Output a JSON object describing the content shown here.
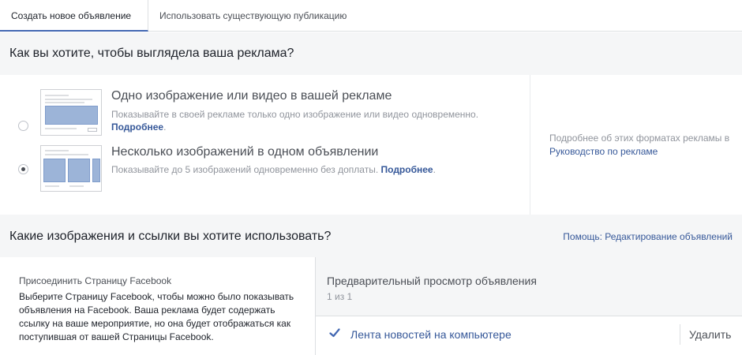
{
  "tabs": [
    {
      "label": "Создать новое объявление",
      "active": true
    },
    {
      "label": "Использовать существующую публикацию",
      "active": false
    }
  ],
  "format_section": {
    "title": "Как вы хотите, чтобы выглядела ваша реклама?",
    "options": [
      {
        "title": "Одно изображение или видео в вашей рекламе",
        "description": "Показывайте в своей рекламе только одно изображение или видео одновременно.",
        "more_link": "Подробнее",
        "selected": false
      },
      {
        "title": "Несколько изображений в одном объявлении",
        "description": "Показывайте до 5 изображений одновременно без доплаты.",
        "more_link": "Подробнее",
        "selected": true
      }
    ],
    "info_text": "Подробнее об этих форматах рекламы в",
    "info_link": "Руководство по рекламе"
  },
  "media_section": {
    "title": "Какие изображения и ссылки вы хотите использовать?",
    "help_link": "Помощь: Редактирование объявлений"
  },
  "facebook_page": {
    "title": "Присоединить Страницу Facebook",
    "description": "Выберите Страницу Facebook, чтобы можно было показывать объявления на Facebook. Ваша реклама будет содержать ссылку на ваше мероприятие, но она будет отображаться как поступившая от вашей Страницы Facebook."
  },
  "preview": {
    "title": "Предварительный просмотр объявления",
    "count": "1 из 1",
    "placement_label": "Лента новостей на компьютере",
    "remove_label": "Удалить"
  },
  "colors": {
    "link": "#365899",
    "accent": "#4267b2",
    "panel_bg": "#f5f6f7"
  }
}
